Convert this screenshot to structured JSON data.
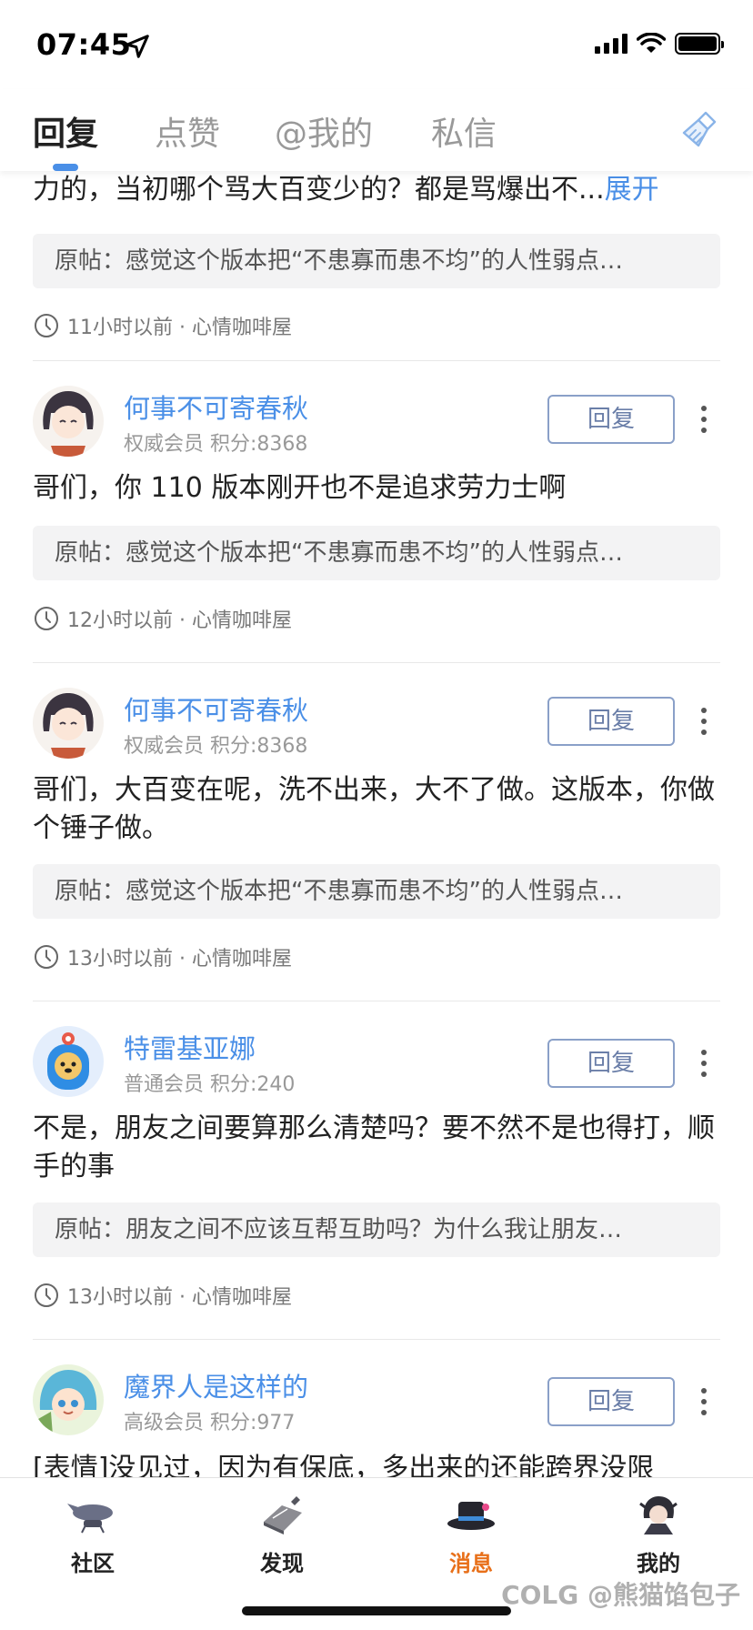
{
  "status_bar": {
    "time": "07:45"
  },
  "tabs": [
    {
      "label": "回复",
      "active": true
    },
    {
      "label": "点赞",
      "active": false
    },
    {
      "label": "@我的",
      "active": false
    },
    {
      "label": "私信",
      "active": false
    }
  ],
  "partial_item": {
    "content": "力的，当初哪个骂大百变少的？都是骂爆出不...",
    "expand": "展开",
    "quote": "原帖：感觉这个版本把“不患寡而患不均”的人性弱点…",
    "time": "11小时以前 · 心情咖啡屋"
  },
  "items": [
    {
      "username": "何事不可寄春秋",
      "member": "权威会员 积分:8368",
      "reply_label": "回复",
      "content": "哥们，你 110 版本刚开也不是追求劳力士啊",
      "quote": "原帖：感觉这个版本把“不患寡而患不均”的人性弱点…",
      "time": "12小时以前 · 心情咖啡屋"
    },
    {
      "username": "何事不可寄春秋",
      "member": "权威会员 积分:8368",
      "reply_label": "回复",
      "content": "哥们，大百变在呢，洗不出来，大不了做。这版本，你做个锤子做。",
      "quote": "原帖：感觉这个版本把“不患寡而患不均”的人性弱点…",
      "time": "13小时以前 · 心情咖啡屋"
    },
    {
      "username": "特雷基亚娜",
      "member": "普通会员 积分:240",
      "reply_label": "回复",
      "content": "不是，朋友之间要算那么清楚吗？要不然不是也得打，顺手的事",
      "quote": "原帖：朋友之间不应该互帮互助吗？为什么我让朋友…",
      "time": "13小时以前 · 心情咖啡屋"
    },
    {
      "username": "魔界人是这样的",
      "member": "高级会员 积分:977",
      "reply_label": "回复",
      "content": "[表情]没见过，因为有保底，多出来的还能跨界没限"
    }
  ],
  "bottom_nav": [
    {
      "label": "社区",
      "active": false
    },
    {
      "label": "发现",
      "active": false
    },
    {
      "label": "消息",
      "active": true
    },
    {
      "label": "我的",
      "active": false
    }
  ],
  "watermark": "COLG @熊猫馅包子",
  "colors": {
    "accent": "#4a8fe7",
    "active_nav": "#e8701a"
  }
}
